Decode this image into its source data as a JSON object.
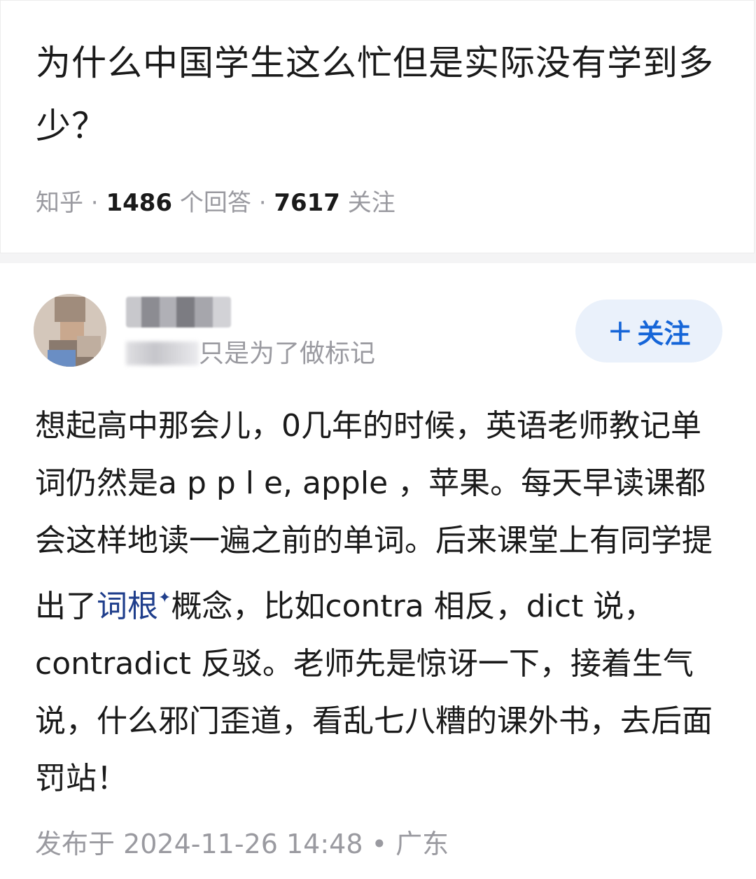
{
  "question": {
    "title": "为什么中国学生这么忙但是实际没有学到多少？",
    "source": "知乎",
    "separator": " · ",
    "answer_count": "1486",
    "answer_label": " 个回答",
    "follower_count": "7617",
    "follower_label": " 关注"
  },
  "answer": {
    "author_bio_visible": "只是为了做标记",
    "follow_button": {
      "icon": "plus-icon",
      "label": "关注"
    },
    "body": {
      "text_before_link": "想起高中那会儿，0几年的时候，英语老师教记单词仍然是a p p l e, apple ，苹果。每天早读课都会这样地读一遍之前的单词。后来课堂上有同学提出了",
      "link_text": "词根",
      "link_icon": "sparkle-icon",
      "text_after_link": "概念，比如contra 相反，dict 说，contradict 反驳。老师先是惊讶一下，接着生气说，什么邪门歪道，看乱七八糟的课外书，去后面罚站！"
    },
    "published_label": "发布于 2024-11-26 14:48 • 广东"
  },
  "colors": {
    "accent": "#1565d8",
    "follow_bg": "#eaf1fb",
    "link": "#1f3e8c",
    "muted": "#9a9aa0"
  }
}
